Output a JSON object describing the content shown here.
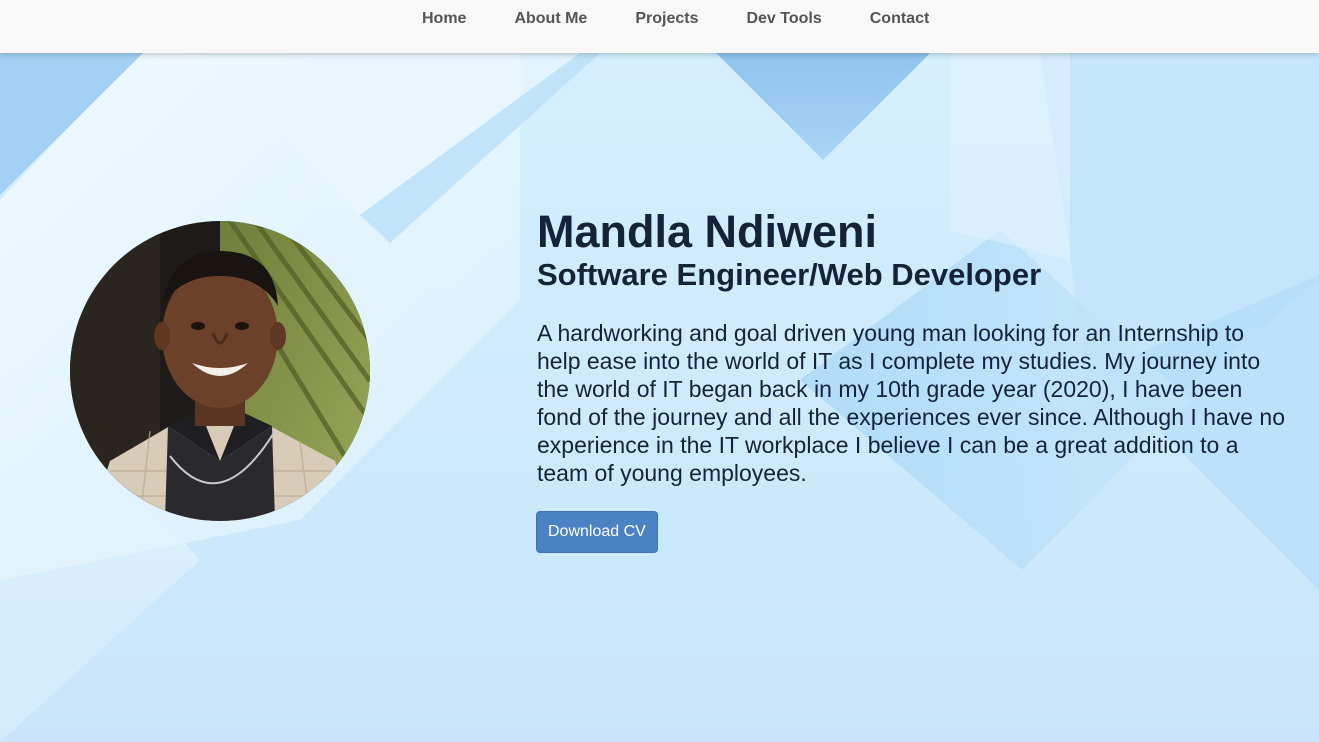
{
  "nav": {
    "items": [
      {
        "label": "Home"
      },
      {
        "label": "About Me"
      },
      {
        "label": "Projects"
      },
      {
        "label": "Dev Tools"
      },
      {
        "label": "Contact"
      }
    ]
  },
  "hero": {
    "name": "Mandla Ndiweni",
    "role": "Software Engineer/Web Developer",
    "bio": "A hardworking and goal driven young man looking for an Internship to help ease into the world of IT as I complete my studies. My journey into the world of IT began back in my 10th grade year (2020), I have been fond of the journey and all the experiences ever since. Although I have no experience in the IT workplace I believe I can be a great addition to a team of young employees.",
    "cv_button_label": "Download CV"
  },
  "colors": {
    "accent": "#4a82c3",
    "text": "#14233a",
    "nav_text": "#555555",
    "nav_bg": "#f8f8f8"
  }
}
